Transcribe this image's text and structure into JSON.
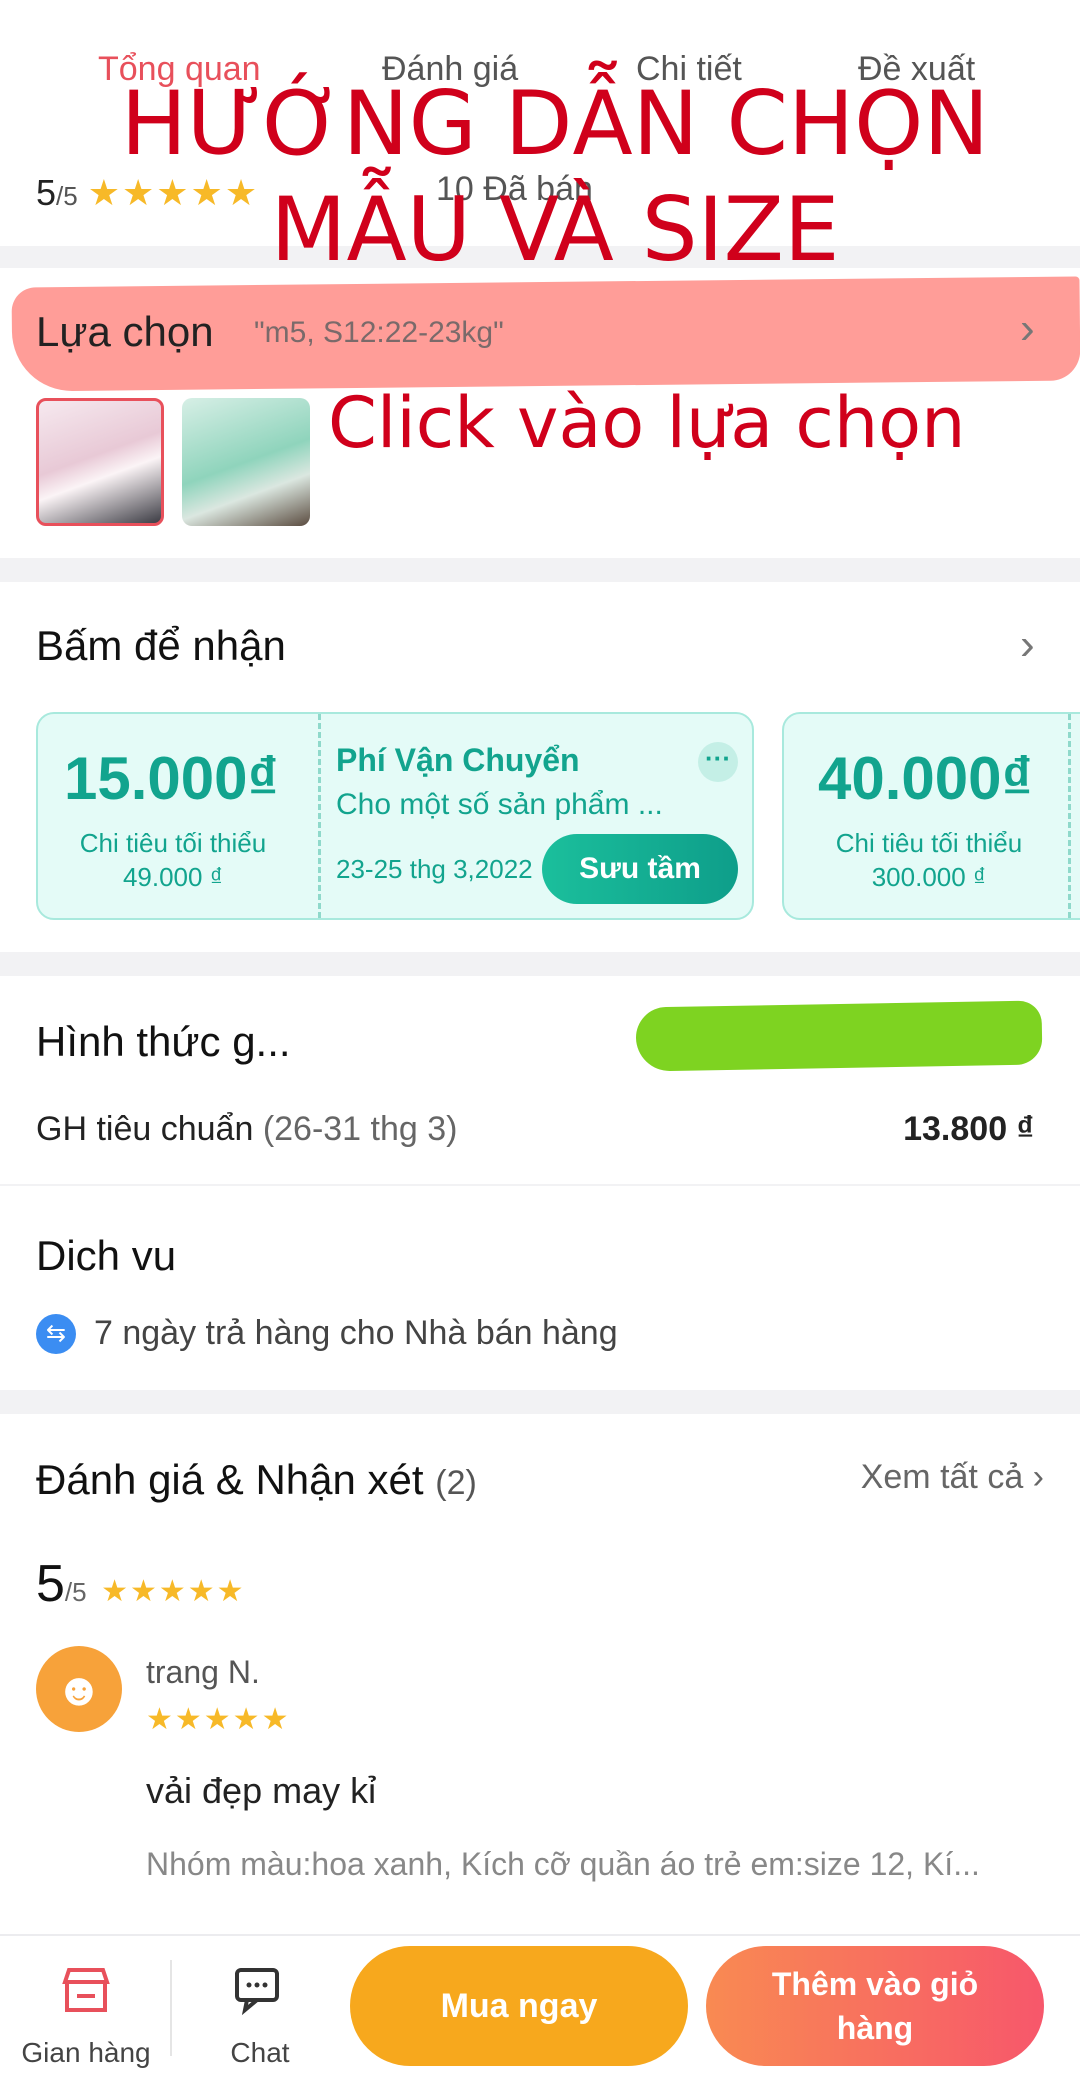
{
  "tabs": [
    {
      "label": "Tổng quan",
      "active": true
    },
    {
      "label": "Đánh giá",
      "active": false
    },
    {
      "label": "Chi tiết",
      "active": false
    },
    {
      "label": "Đề xuất",
      "active": false
    }
  ],
  "overview": {
    "rating_value": "5",
    "rating_max": "/5",
    "stars": "★★★★★",
    "sold": "10 Đã bán"
  },
  "annotations": {
    "title_line1": "HƯỚNG DẪN CHỌN",
    "title_line2": "MẪU VÀ SIZE",
    "click_note": "Click vào lựa chọn",
    "highlight_color": "#ff8c86",
    "blob_color": "#7ed321"
  },
  "options": {
    "label": "Lựa chọn",
    "selected": "\"m5, S12:22-23kg\"",
    "chevron": "›"
  },
  "vouchers": {
    "title": "Bấm để nhận",
    "chevron": "›",
    "cards": [
      {
        "amount": "15.000₫",
        "min_label": "Chi tiêu tối thiểu",
        "min_value": "49.000 ₫"
      },
      {
        "title": "Phí Vận Chuyển",
        "desc": "Cho một số sản phẩm ...",
        "date": "23-25 thg 3,2022",
        "button": "Sưu tầm",
        "more": "···"
      },
      {
        "amount": "40.000₫",
        "min_label": "Chi tiêu tối thiểu",
        "min_value": "300.000 ₫"
      }
    ],
    "accent_color": "#12a48e"
  },
  "delivery": {
    "title": "Hình thức g...",
    "method": "GH tiêu chuẩn",
    "range": "(26-31 thg 3)",
    "price": "13.800 ₫"
  },
  "service": {
    "title": "Dich vu",
    "icon": "return-icon",
    "text": "7 ngày trả hàng cho Nhà bán hàng"
  },
  "reviews": {
    "title": "Đánh giá & Nhận xét",
    "count": "(2)",
    "see_all": "Xem tất cả ›",
    "score": "5",
    "score_max": "/5",
    "stars": "★★★★★",
    "items": [
      {
        "user": "trang N.",
        "stars": "★★★★★",
        "text": "vải đẹp may kỉ",
        "variant": "Nhóm màu:hoa xanh, Kích cỡ quần áo trẻ em:size 12, Kí..."
      }
    ]
  },
  "bottom_bar": {
    "store_label": "Gian hàng",
    "chat_label": "Chat",
    "buy_now": "Mua ngay",
    "add_to_cart": "Thêm vào giỏ hàng",
    "buy_color": "#f7a81d",
    "cart_color": "#f7576b"
  }
}
